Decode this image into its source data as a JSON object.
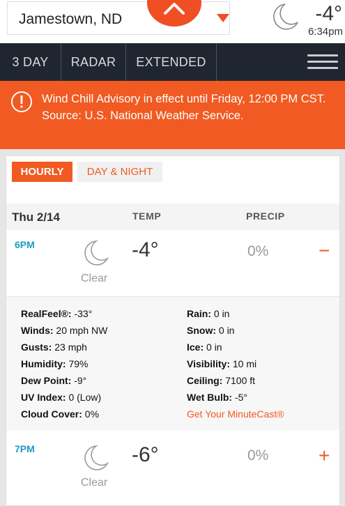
{
  "header": {
    "location": "Jamestown, ND",
    "current_temp": "-4°",
    "current_time": "6:34pm",
    "condition_icon": "moon-icon"
  },
  "nav": {
    "items": [
      "3 DAY",
      "RADAR",
      "EXTENDED"
    ],
    "menu_icon": "hamburger-menu-icon"
  },
  "alert": {
    "icon": "alert-circle-icon",
    "text": "Wind Chill Advisory in effect until Friday, 12:00 PM CST. Source: U.S. National Weather Service."
  },
  "tabs": {
    "hourly": "HOURLY",
    "day_night": "DAY & NIGHT"
  },
  "table": {
    "date": "Thu 2/14",
    "temp_header": "TEMP",
    "precip_header": "PRECIP"
  },
  "hours": [
    {
      "time": "6PM",
      "condition": "Clear",
      "temp": "-4°",
      "precip": "0%",
      "toggle": "−",
      "details_left": [
        {
          "label": "RealFeel®:",
          "value": " -33°"
        },
        {
          "label": "Winds:",
          "value": " 20 mph NW"
        },
        {
          "label": "Gusts:",
          "value": " 23 mph"
        },
        {
          "label": "Humidity:",
          "value": " 79%"
        },
        {
          "label": "Dew Point:",
          "value": " -9°"
        },
        {
          "label": "UV Index:",
          "value": " 0 (Low)"
        },
        {
          "label": "Cloud Cover:",
          "value": " 0%"
        }
      ],
      "details_right": [
        {
          "label": "Rain:",
          "value": " 0 in"
        },
        {
          "label": "Snow:",
          "value": " 0 in"
        },
        {
          "label": "Ice:",
          "value": " 0 in"
        },
        {
          "label": "Visibility:",
          "value": " 10 mi"
        },
        {
          "label": "Ceiling:",
          "value": " 7100 ft"
        },
        {
          "label": "Wet Bulb:",
          "value": " -5°"
        }
      ],
      "minutecast_link": "Get Your MinuteCast®"
    },
    {
      "time": "7PM",
      "condition": "Clear",
      "temp": "-6°",
      "precip": "0%",
      "toggle": "+"
    }
  ],
  "colors": {
    "accent": "#f15a22",
    "nav_bg": "#20262f",
    "hour_label": "#1d9ac2"
  }
}
